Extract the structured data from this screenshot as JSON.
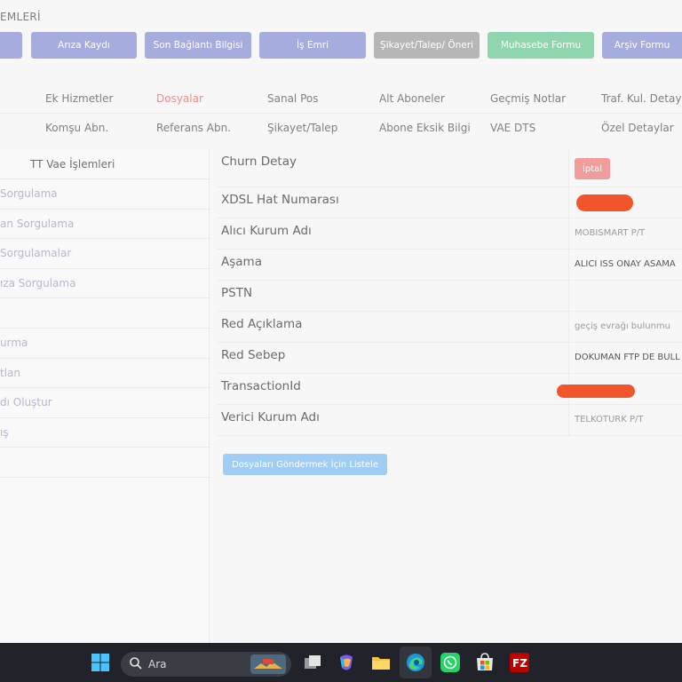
{
  "section": {
    "title": "EMLERİ"
  },
  "top_buttons": [
    {
      "label": "",
      "color": "#a6acde"
    },
    {
      "label": "Arıza Kaydı",
      "color": "#a6acde"
    },
    {
      "label": "Son Bağlantı Bilgisi",
      "color": "#a6acde"
    },
    {
      "label": "İş Emri",
      "color": "#a6acde"
    },
    {
      "label": "Şikayet/Talep/ Öneri",
      "color": "#b6b6b6"
    },
    {
      "label": "Muhasebe Formu",
      "color": "#8fd5ad"
    },
    {
      "label": "Arşiv Formu",
      "color": "#a6acde"
    }
  ],
  "tabs_row1": [
    "Ek Hizmetler",
    "Dosyalar",
    "Sanal Pos",
    "Alt Aboneler",
    "Geçmiş Notlar",
    "Traf. Kul. Detayı"
  ],
  "tabs_row2": [
    "Komşu Abn.",
    "Referans Abn.",
    "Şikayet/Talep",
    "Abone Eksik Bilgi",
    "VAE DTS",
    "Özel Detaylar"
  ],
  "active_tab": "Dosyalar",
  "left_menu": {
    "header": "TT Vae İşlemleri",
    "items": [
      "Sorgulama",
      "an Sorgulama",
      "Sorgulamalar",
      "ıza Sorgulama",
      "",
      "urma",
      "tlan",
      "dı Oluştur",
      "ış",
      ""
    ]
  },
  "detail": {
    "rows": [
      {
        "label": "Churn Detay",
        "value": "",
        "badge": "İptal"
      },
      {
        "label": "XDSL Hat Numarası",
        "value": "",
        "redacted": true
      },
      {
        "label": "Alıcı Kurum Adı",
        "value": "MOBISMART P/T"
      },
      {
        "label": "Aşama",
        "value": "ALICI ISS ONAY ASAMA",
        "dark": true
      },
      {
        "label": "PSTN",
        "value": ""
      },
      {
        "label": "Red Açıklama",
        "value": "geçiş evrağı bulunmu"
      },
      {
        "label": "Red Sebep",
        "value": "DOKUMAN FTP DE BULL",
        "dark": true
      },
      {
        "label": "TransactionId",
        "value": "",
        "redacted": true
      },
      {
        "label": "Verici Kurum Adı",
        "value": "TELKOTURK P/T"
      }
    ],
    "redact_color": "#f2552c",
    "badge_color": "#f29b9b"
  },
  "list_button": {
    "label": "Dosyaları Göndermek İçin Listele"
  },
  "taskbar": {
    "search_placeholder": "Ara",
    "icons": [
      "windows-start-icon",
      "search-icon",
      "task-view-icon",
      "copilot-icon",
      "file-explorer-icon",
      "edge-browser-icon",
      "whatsapp-icon",
      "microsoft-store-icon",
      "filezilla-icon"
    ]
  }
}
